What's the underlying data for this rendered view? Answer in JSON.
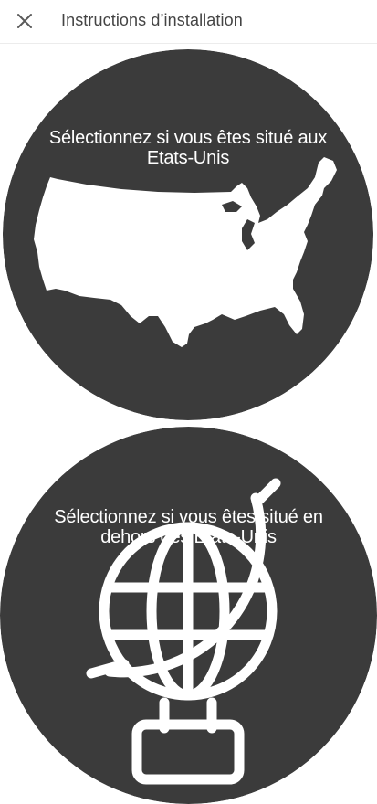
{
  "header": {
    "title": "Instructions d’installation",
    "close_icon": "close-icon"
  },
  "options": [
    {
      "label": "Sélectionnez si vous êtes situé aux\nEtats-Unis",
      "icon": "us-map-icon"
    },
    {
      "label": "Sélectionnez si vous êtes situé en\ndehors des Etats-Unis",
      "icon": "globe-icon"
    }
  ],
  "colors": {
    "circle": "#3b3b3b",
    "icon": "#ffffff",
    "header_text": "#444444"
  }
}
